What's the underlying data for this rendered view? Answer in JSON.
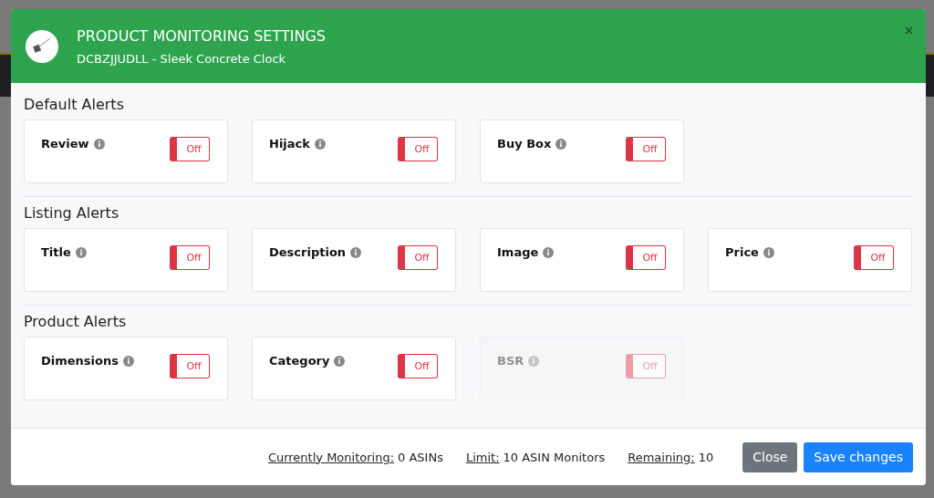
{
  "modal": {
    "title": "PRODUCT MONITORING SETTINGS",
    "subtitle": "DCBZJJUDLL - Sleek Concrete Clock",
    "close": "×"
  },
  "sections": [
    {
      "heading": "Default Alerts",
      "alerts": [
        {
          "label": "Review",
          "on": false,
          "disabled": false,
          "state": "Off"
        },
        {
          "label": "Hijack",
          "on": false,
          "disabled": false,
          "state": "Off"
        },
        {
          "label": "Buy Box",
          "on": false,
          "disabled": false,
          "state": "Off"
        }
      ]
    },
    {
      "heading": "Listing Alerts",
      "alerts": [
        {
          "label": "Title",
          "on": false,
          "disabled": false,
          "state": "Off"
        },
        {
          "label": "Description",
          "on": false,
          "disabled": false,
          "state": "Off"
        },
        {
          "label": "Image",
          "on": false,
          "disabled": false,
          "state": "Off"
        },
        {
          "label": "Price",
          "on": false,
          "disabled": false,
          "state": "Off"
        }
      ]
    },
    {
      "heading": "Product Alerts",
      "alerts": [
        {
          "label": "Dimensions",
          "on": false,
          "disabled": false,
          "state": "Off"
        },
        {
          "label": "Category",
          "on": false,
          "disabled": false,
          "state": "Off"
        },
        {
          "label": "BSR",
          "on": false,
          "disabled": true,
          "state": "Off"
        }
      ]
    }
  ],
  "footer": {
    "stats": [
      {
        "label": "Currently Monitoring:",
        "value": "0 ASINs"
      },
      {
        "label": "Limit:",
        "value": "10 ASIN Monitors"
      },
      {
        "label": "Remaining:",
        "value": "10"
      }
    ],
    "buttons": [
      {
        "label": "Close",
        "kind": "secondary"
      },
      {
        "label": "Save changes",
        "kind": "primary"
      }
    ]
  }
}
